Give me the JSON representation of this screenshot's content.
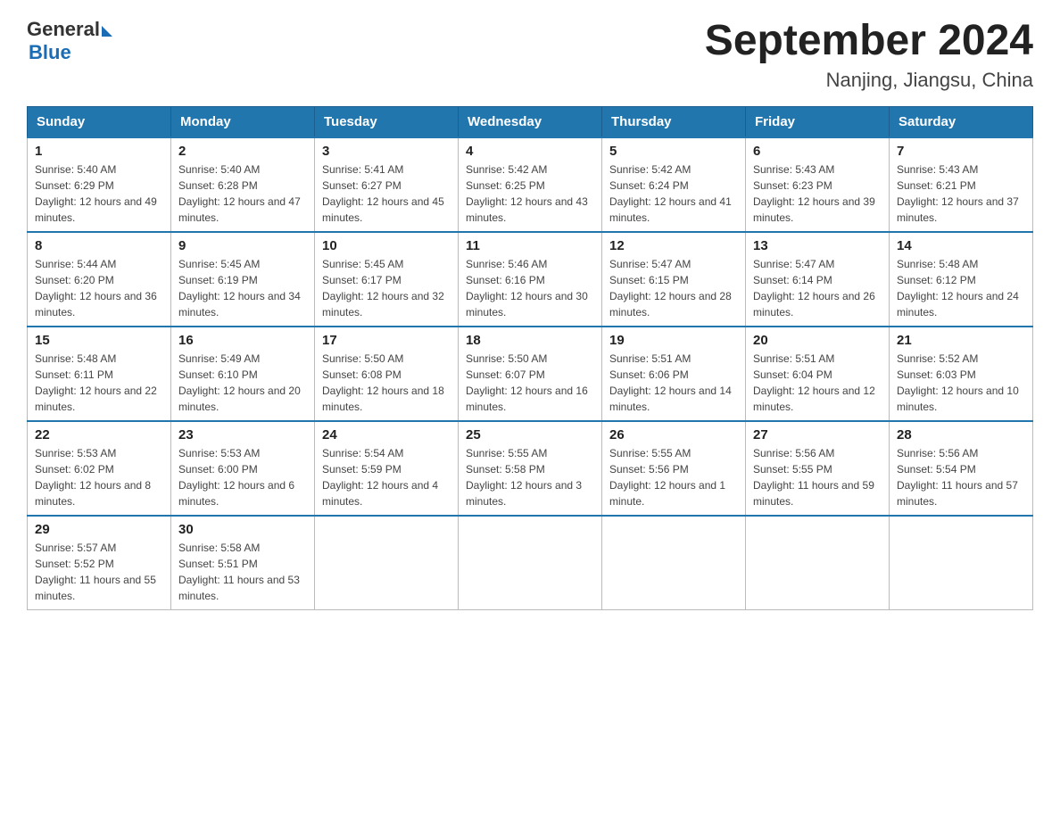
{
  "header": {
    "logo_general": "General",
    "logo_blue": "Blue",
    "title": "September 2024",
    "subtitle": "Nanjing, Jiangsu, China"
  },
  "days_of_week": [
    "Sunday",
    "Monday",
    "Tuesday",
    "Wednesday",
    "Thursday",
    "Friday",
    "Saturday"
  ],
  "weeks": [
    [
      {
        "day": "1",
        "sunrise": "5:40 AM",
        "sunset": "6:29 PM",
        "daylight": "12 hours and 49 minutes."
      },
      {
        "day": "2",
        "sunrise": "5:40 AM",
        "sunset": "6:28 PM",
        "daylight": "12 hours and 47 minutes."
      },
      {
        "day": "3",
        "sunrise": "5:41 AM",
        "sunset": "6:27 PM",
        "daylight": "12 hours and 45 minutes."
      },
      {
        "day": "4",
        "sunrise": "5:42 AM",
        "sunset": "6:25 PM",
        "daylight": "12 hours and 43 minutes."
      },
      {
        "day": "5",
        "sunrise": "5:42 AM",
        "sunset": "6:24 PM",
        "daylight": "12 hours and 41 minutes."
      },
      {
        "day": "6",
        "sunrise": "5:43 AM",
        "sunset": "6:23 PM",
        "daylight": "12 hours and 39 minutes."
      },
      {
        "day": "7",
        "sunrise": "5:43 AM",
        "sunset": "6:21 PM",
        "daylight": "12 hours and 37 minutes."
      }
    ],
    [
      {
        "day": "8",
        "sunrise": "5:44 AM",
        "sunset": "6:20 PM",
        "daylight": "12 hours and 36 minutes."
      },
      {
        "day": "9",
        "sunrise": "5:45 AM",
        "sunset": "6:19 PM",
        "daylight": "12 hours and 34 minutes."
      },
      {
        "day": "10",
        "sunrise": "5:45 AM",
        "sunset": "6:17 PM",
        "daylight": "12 hours and 32 minutes."
      },
      {
        "day": "11",
        "sunrise": "5:46 AM",
        "sunset": "6:16 PM",
        "daylight": "12 hours and 30 minutes."
      },
      {
        "day": "12",
        "sunrise": "5:47 AM",
        "sunset": "6:15 PM",
        "daylight": "12 hours and 28 minutes."
      },
      {
        "day": "13",
        "sunrise": "5:47 AM",
        "sunset": "6:14 PM",
        "daylight": "12 hours and 26 minutes."
      },
      {
        "day": "14",
        "sunrise": "5:48 AM",
        "sunset": "6:12 PM",
        "daylight": "12 hours and 24 minutes."
      }
    ],
    [
      {
        "day": "15",
        "sunrise": "5:48 AM",
        "sunset": "6:11 PM",
        "daylight": "12 hours and 22 minutes."
      },
      {
        "day": "16",
        "sunrise": "5:49 AM",
        "sunset": "6:10 PM",
        "daylight": "12 hours and 20 minutes."
      },
      {
        "day": "17",
        "sunrise": "5:50 AM",
        "sunset": "6:08 PM",
        "daylight": "12 hours and 18 minutes."
      },
      {
        "day": "18",
        "sunrise": "5:50 AM",
        "sunset": "6:07 PM",
        "daylight": "12 hours and 16 minutes."
      },
      {
        "day": "19",
        "sunrise": "5:51 AM",
        "sunset": "6:06 PM",
        "daylight": "12 hours and 14 minutes."
      },
      {
        "day": "20",
        "sunrise": "5:51 AM",
        "sunset": "6:04 PM",
        "daylight": "12 hours and 12 minutes."
      },
      {
        "day": "21",
        "sunrise": "5:52 AM",
        "sunset": "6:03 PM",
        "daylight": "12 hours and 10 minutes."
      }
    ],
    [
      {
        "day": "22",
        "sunrise": "5:53 AM",
        "sunset": "6:02 PM",
        "daylight": "12 hours and 8 minutes."
      },
      {
        "day": "23",
        "sunrise": "5:53 AM",
        "sunset": "6:00 PM",
        "daylight": "12 hours and 6 minutes."
      },
      {
        "day": "24",
        "sunrise": "5:54 AM",
        "sunset": "5:59 PM",
        "daylight": "12 hours and 4 minutes."
      },
      {
        "day": "25",
        "sunrise": "5:55 AM",
        "sunset": "5:58 PM",
        "daylight": "12 hours and 3 minutes."
      },
      {
        "day": "26",
        "sunrise": "5:55 AM",
        "sunset": "5:56 PM",
        "daylight": "12 hours and 1 minute."
      },
      {
        "day": "27",
        "sunrise": "5:56 AM",
        "sunset": "5:55 PM",
        "daylight": "11 hours and 59 minutes."
      },
      {
        "day": "28",
        "sunrise": "5:56 AM",
        "sunset": "5:54 PM",
        "daylight": "11 hours and 57 minutes."
      }
    ],
    [
      {
        "day": "29",
        "sunrise": "5:57 AM",
        "sunset": "5:52 PM",
        "daylight": "11 hours and 55 minutes."
      },
      {
        "day": "30",
        "sunrise": "5:58 AM",
        "sunset": "5:51 PM",
        "daylight": "11 hours and 53 minutes."
      },
      null,
      null,
      null,
      null,
      null
    ]
  ],
  "labels": {
    "sunrise_prefix": "Sunrise: ",
    "sunset_prefix": "Sunset: ",
    "daylight_prefix": "Daylight: "
  }
}
